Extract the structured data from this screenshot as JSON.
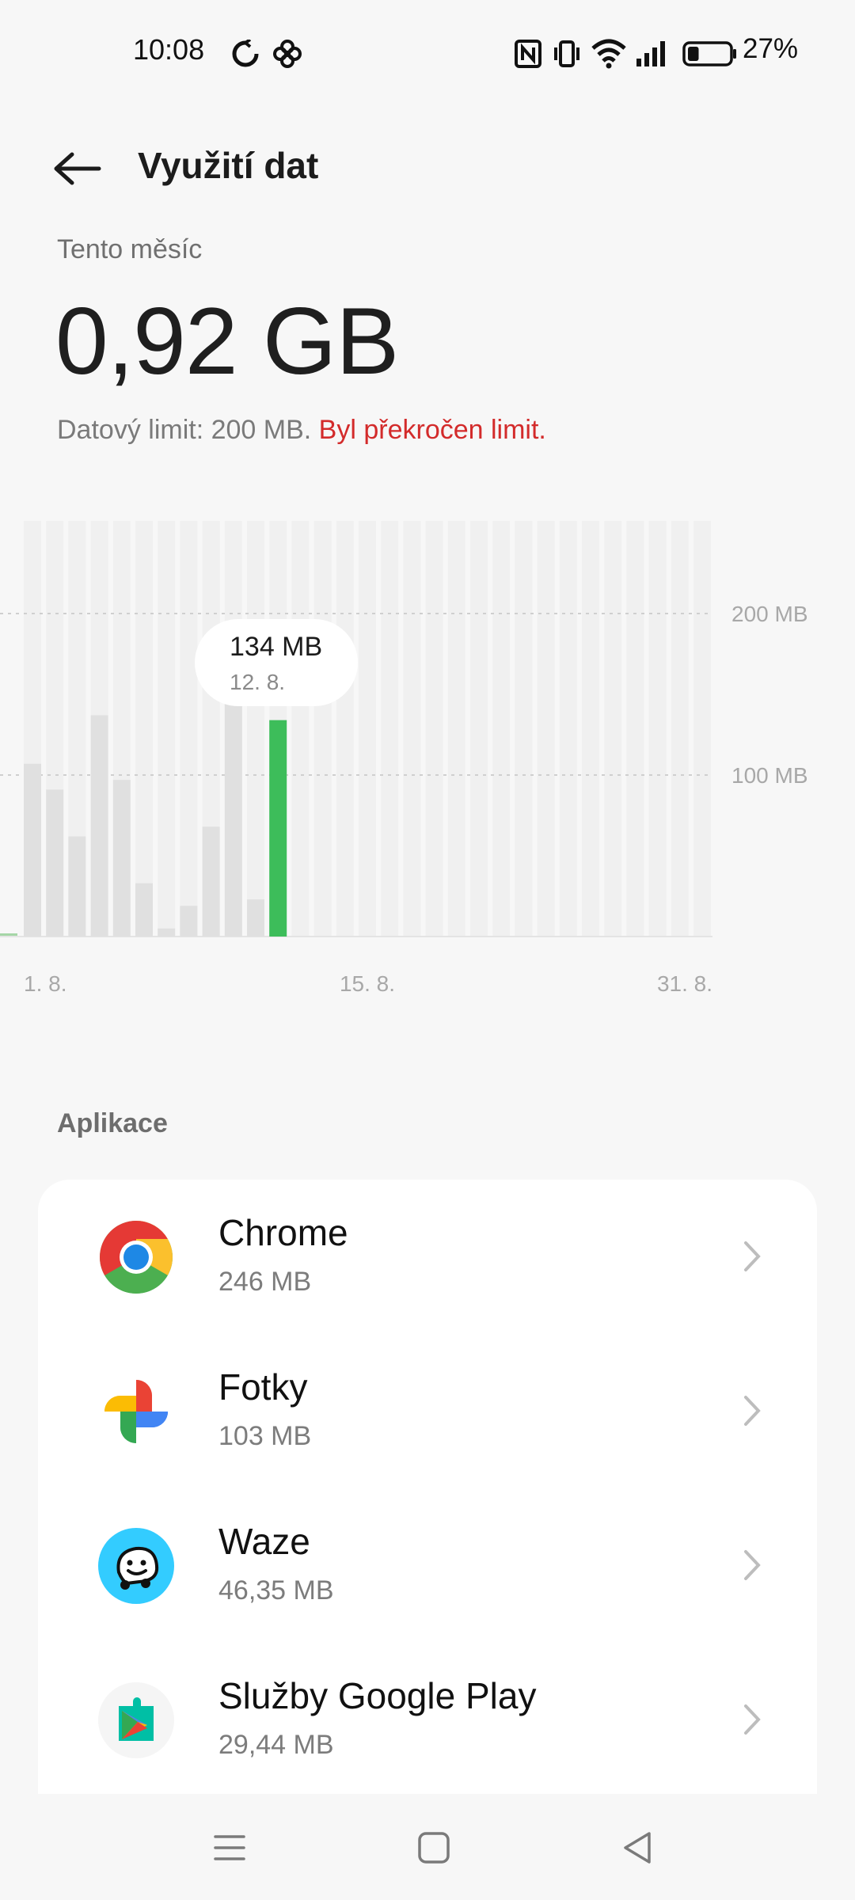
{
  "status_bar": {
    "time": "10:08",
    "battery_percent": "27%",
    "battery_level": 0.27,
    "icons": [
      "sync-icon",
      "pinwheel-icon",
      "nfc-icon",
      "vibrate-icon",
      "wifi-icon",
      "signal-icon",
      "battery-icon"
    ]
  },
  "header": {
    "title": "Využití dat",
    "back_icon": "arrow-left-icon"
  },
  "summary": {
    "period": "Tento měsíc",
    "total": "0,92 GB",
    "limit_text": "Datový limit: 200 MB.",
    "limit_warning": "Byl překročen limit.",
    "warning_color": "#d32b2b"
  },
  "chart_data": {
    "type": "bar",
    "x_labels": [
      "1. 8.",
      "15. 8.",
      "31. 8."
    ],
    "categories": [
      "1. 8.",
      "2. 8.",
      "3. 8.",
      "4. 8.",
      "5. 8.",
      "6. 8.",
      "7. 8.",
      "8. 8.",
      "9. 8.",
      "10. 8.",
      "11. 8.",
      "12. 8."
    ],
    "values": [
      107,
      91,
      62,
      137,
      97,
      33,
      5,
      19,
      68,
      144,
      23,
      134
    ],
    "highlighted_index": 11,
    "highlight_color": "#3dbd5a",
    "bar_color": "#e0e0e0",
    "days_in_month": 31,
    "y_gridlines": [
      {
        "value": 200,
        "label": "200 MB"
      },
      {
        "value": 100,
        "label": "100 MB"
      }
    ],
    "unit": "MB",
    "tooltip": {
      "value": "134 MB",
      "date": "12. 8."
    }
  },
  "apps_section": {
    "heading": "Aplikace",
    "items": [
      {
        "name": "Chrome",
        "usage": "246 MB",
        "icon": "chrome-icon"
      },
      {
        "name": "Fotky",
        "usage": "103 MB",
        "icon": "google-photos-icon"
      },
      {
        "name": "Waze",
        "usage": "46,35 MB",
        "icon": "waze-icon"
      },
      {
        "name": "Služby Google Play",
        "usage": "29,44 MB",
        "icon": "google-play-services-icon"
      }
    ]
  },
  "nav_bar": {
    "buttons": [
      "menu-icon",
      "home-icon",
      "back-triangle-icon"
    ]
  }
}
